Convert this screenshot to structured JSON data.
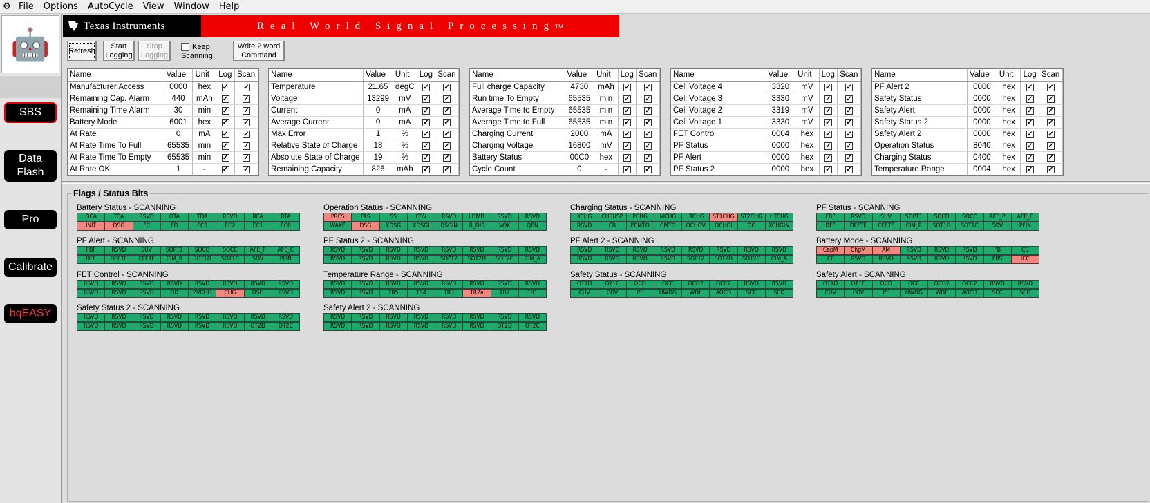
{
  "menu": [
    "File",
    "Options",
    "AutoCycle",
    "View",
    "Window",
    "Help"
  ],
  "nav": {
    "sbs": "SBS",
    "data_flash_1": "Data",
    "data_flash_2": "Flash",
    "pro": "Pro",
    "calibrate": "Calibrate",
    "bqeasy": "bqEASY"
  },
  "banner": {
    "ti": "Texas Instruments",
    "rwsp": "Real World Signal Processing",
    "tm": "TM"
  },
  "toolbar": {
    "refresh": "Refresh",
    "start_1": "Start",
    "start_2": "Logging",
    "stop_1": "Stop",
    "stop_2": "Logging",
    "keep_1": "Keep",
    "keep_2": "Scanning",
    "write_1": "Write 2 word",
    "write_2": "Command"
  },
  "grid_headers": {
    "name": "Name",
    "value": "Value",
    "unit": "Unit",
    "log": "Log",
    "scan": "Scan"
  },
  "grids": [
    {
      "rows": [
        [
          "Manufacturer Access",
          "0000",
          "hex"
        ],
        [
          "Remaining Cap. Alarm",
          "440",
          "mAh"
        ],
        [
          "Remaining Time Alarm",
          "30",
          "min"
        ],
        [
          "Battery Mode",
          "6001",
          "hex"
        ],
        [
          "At Rate",
          "0",
          "mA"
        ],
        [
          "At Rate Time To Full",
          "65535",
          "min"
        ],
        [
          "At Rate Time To Empty",
          "65535",
          "min"
        ],
        [
          "At Rate OK",
          "1",
          "-"
        ]
      ]
    },
    {
      "rows": [
        [
          "Temperature",
          "21.65",
          "degC"
        ],
        [
          "Voltage",
          "13299",
          "mV"
        ],
        [
          "Current",
          "0",
          "mA"
        ],
        [
          "Average Current",
          "0",
          "mA"
        ],
        [
          "Max Error",
          "1",
          "%"
        ],
        [
          "Relative State of Charge",
          "18",
          "%"
        ],
        [
          "Absolute State of Charge",
          "19",
          "%"
        ],
        [
          "Remaining Capacity",
          "826",
          "mAh"
        ]
      ]
    },
    {
      "rows": [
        [
          "Full charge Capacity",
          "4730",
          "mAh"
        ],
        [
          "Run time To Empty",
          "65535",
          "min"
        ],
        [
          "Average Time to Empty",
          "65535",
          "min"
        ],
        [
          "Average Time to Full",
          "65535",
          "min"
        ],
        [
          "Charging Current",
          "2000",
          "mA"
        ],
        [
          "Charging Voltage",
          "16800",
          "mV"
        ],
        [
          "Battery Status",
          "00C0",
          "hex"
        ],
        [
          "Cycle Count",
          "0",
          "-"
        ]
      ]
    },
    {
      "rows": [
        [
          "Cell Voltage 4",
          "3320",
          "mV"
        ],
        [
          "Cell Voltage 3",
          "3330",
          "mV"
        ],
        [
          "Cell Voltage 2",
          "3319",
          "mV"
        ],
        [
          "Cell Voltage 1",
          "3330",
          "mV"
        ],
        [
          "FET Control",
          "0004",
          "hex"
        ],
        [
          "PF Status",
          "0000",
          "hex"
        ],
        [
          "PF Alert",
          "0000",
          "hex"
        ],
        [
          "PF Status 2",
          "0000",
          "hex"
        ]
      ]
    },
    {
      "rows": [
        [
          "PF Alert 2",
          "0000",
          "hex"
        ],
        [
          "Safety Status",
          "0000",
          "hex"
        ],
        [
          "Safety Alert",
          "0000",
          "hex"
        ],
        [
          "Safety Status 2",
          "0000",
          "hex"
        ],
        [
          "Safety Alert 2",
          "0000",
          "hex"
        ],
        [
          "Operation Status",
          "8040",
          "hex"
        ],
        [
          "Charging Status",
          "0400",
          "hex"
        ],
        [
          "Temperature Range",
          "0004",
          "hex"
        ]
      ]
    }
  ],
  "flags_title": "Flags / Status Bits",
  "flag_groups": [
    {
      "title": "Battery Status - SCANNING",
      "rows": [
        [
          "OCA",
          "TCA",
          "RSVD",
          "OTA",
          "TDA",
          "RSVD",
          "RCA",
          "RTA"
        ],
        [
          "INIT",
          "DSG",
          "FC",
          "FD",
          "EC3",
          "EC2",
          "EC1",
          "EC0"
        ]
      ],
      "on": [
        [],
        [
          "INIT",
          "DSG"
        ]
      ]
    },
    {
      "title": "Operation Status - SCANNING",
      "rows": [
        [
          "PRES",
          "FAS",
          "SS",
          "CSV",
          "RSVD",
          "LDMD",
          "RSVD",
          "RSVD"
        ],
        [
          "WAKE",
          "DSG",
          "XDSG",
          "XDSGI",
          "DSGIN",
          "R_DIS",
          "VOK",
          "QEN"
        ]
      ],
      "on": [
        [
          "PRES"
        ],
        [
          "DSG"
        ]
      ]
    },
    {
      "title": "Charging Status - SCANNING",
      "rows": [
        [
          "XCHG",
          "CHSUSP",
          "PCHG",
          "MCHG",
          "LTCHG",
          "ST1CHG",
          "ST2CHG",
          "HTCHG"
        ],
        [
          "RSVD",
          "CB",
          "PCMTO",
          "CMTO",
          "OCHGV",
          "OCHGI",
          "OC",
          "XCHGLV"
        ]
      ],
      "on": [
        [
          "ST1CHG"
        ],
        []
      ]
    },
    {
      "title": "PF Status - SCANNING",
      "rows": [
        [
          "FBF",
          "RSVD",
          "SUV",
          "SOPT1",
          "SOCD",
          "SOCC",
          "AFE_P",
          "AFE_C"
        ],
        [
          "DFF",
          "DFETF",
          "CFETF",
          "CIM_R",
          "SOT1D",
          "SOT1C",
          "SOV",
          "PFIN"
        ]
      ],
      "on": [
        [],
        []
      ]
    },
    {
      "title": "PF Alert - SCANNING",
      "rows": [
        [
          "FBF",
          "RSVD",
          "SUV",
          "SOPT1",
          "SOCD",
          "SOCC",
          "AFE_P",
          "AFE_C"
        ],
        [
          "DFF",
          "DFETF",
          "CFETF",
          "CIM_R",
          "SOT1D",
          "SOT1C",
          "SOV",
          "PFIN"
        ]
      ],
      "on": [
        [],
        []
      ]
    },
    {
      "title": "PF Status 2 - SCANNING",
      "rows": [
        [
          "RSVD",
          "RSVD",
          "RSVD",
          "RSVD",
          "RSVD",
          "RSVD",
          "RSVD",
          "RSVD"
        ],
        [
          "RSVD",
          "RSVD",
          "RSVD",
          "RSVD",
          "SOPT2",
          "SOT2D",
          "SOT2C",
          "CIM_A"
        ]
      ],
      "on": [
        [],
        []
      ]
    },
    {
      "title": "PF Alert 2 - SCANNING",
      "rows": [
        [
          "RSVD",
          "RSVD",
          "RSVD",
          "RSVD",
          "RSVD",
          "RSVD",
          "RSVD",
          "RSVD"
        ],
        [
          "RSVD",
          "RSVD",
          "RSVD",
          "RSVD",
          "SOPT2",
          "SOT2D",
          "SOT2C",
          "CIM_A"
        ]
      ],
      "on": [
        [],
        []
      ]
    },
    {
      "title": "Battery Mode - SCANNING",
      "rows": [
        [
          "CapM",
          "ChgM",
          "AM",
          "RSVD",
          "RSVD",
          "RSVD",
          "PB",
          "CC"
        ],
        [
          "CF",
          "RSVD",
          "RSVD",
          "RSVD",
          "RSVD",
          "RSVD",
          "PBS",
          "ICC"
        ]
      ],
      "on": [
        [
          "CapM",
          "ChgM",
          "AM"
        ],
        [
          "ICC"
        ]
      ]
    },
    {
      "title": "FET Control - SCANNING",
      "rows": [
        [
          "RSVD",
          "RSVD",
          "RSVD",
          "RSVD",
          "RSVD",
          "RSVD",
          "RSVD",
          "RSVD"
        ],
        [
          "RSVD",
          "RSVD",
          "RSVD",
          "OD",
          "ZVCHG",
          "CHG",
          "DSG",
          "RSVD"
        ]
      ],
      "on": [
        [],
        [
          "CHG"
        ]
      ]
    },
    {
      "title": "Temperature Range - SCANNING",
      "rows": [
        [
          "RSVD",
          "RSVD",
          "RSVD",
          "RSVD",
          "RSVD",
          "RSVD",
          "RSVD",
          "RSVD"
        ],
        [
          "RSVD",
          "RSVD",
          "TR5",
          "TR4",
          "TR3",
          "TR2a",
          "TR2",
          "TR1"
        ]
      ],
      "on": [
        [],
        [
          "TR2a"
        ]
      ]
    },
    {
      "title": "Safety Status - SCANNING",
      "rows": [
        [
          "OT1D",
          "OT1C",
          "OCD",
          "OCC",
          "OCD2",
          "OCC2",
          "RSVD",
          "RSVD"
        ],
        [
          "CUV",
          "COV",
          "PF",
          "HWDG",
          "WDF",
          "AOCD",
          "SCC",
          "SCD"
        ]
      ],
      "on": [
        [],
        []
      ]
    },
    {
      "title": "Safety Alert - SCANNING",
      "rows": [
        [
          "OT1D",
          "OT1C",
          "OCD",
          "OCC",
          "OCD2",
          "OCC2",
          "RSVD",
          "RSVD"
        ],
        [
          "CUV",
          "COV",
          "PF",
          "HWDG",
          "WDF",
          "AOCD",
          "SCC",
          "SCD"
        ]
      ],
      "on": [
        [],
        []
      ]
    },
    {
      "title": "Safety Status 2 - SCANNING",
      "rows": [
        [
          "RSVD",
          "RSVD",
          "RSVD",
          "RSVD",
          "RSVD",
          "RSVD",
          "RSVD",
          "RSVD"
        ],
        [
          "RSVD",
          "RSVD",
          "RSVD",
          "RSVD",
          "RSVD",
          "RSVD",
          "OT2D",
          "OT2C"
        ]
      ],
      "on": [
        [],
        []
      ]
    },
    {
      "title": "Safety Alert 2 - SCANNING",
      "rows": [
        [
          "RSVD",
          "RSVD",
          "RSVD",
          "RSVD",
          "RSVD",
          "RSVD",
          "RSVD",
          "RSVD"
        ],
        [
          "RSVD",
          "RSVD",
          "RSVD",
          "RSVD",
          "RSVD",
          "RSVD",
          "OT2D",
          "OT2C"
        ]
      ],
      "on": [
        [],
        []
      ]
    }
  ],
  "colors": {
    "bit_off": "#1aab6d",
    "bit_on": "#f3877d",
    "banner_red": "#ee0000",
    "nav_sel_border": "#e00000"
  }
}
